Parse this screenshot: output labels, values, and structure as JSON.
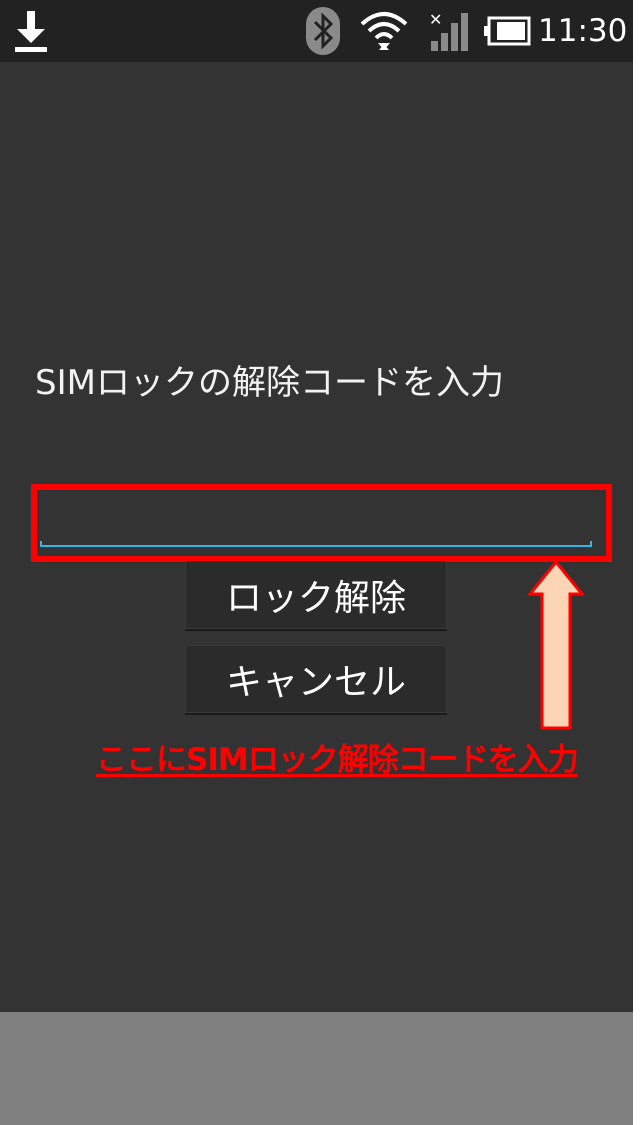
{
  "status_bar": {
    "time": "11:30",
    "icons": [
      "download-icon",
      "bluetooth-icon",
      "wifi-icon",
      "signal-icon",
      "battery-icon"
    ]
  },
  "dialog": {
    "prompt": "SIMロックの解除コードを入力",
    "input_value": "",
    "input_placeholder": "",
    "unlock_label": "ロック解除",
    "cancel_label": "キャンセル"
  },
  "annotation": {
    "text": "ここにSIMロック解除コードを入力"
  },
  "colors": {
    "background": "#333333",
    "status_bar": "#222222",
    "highlight": "#ff0000",
    "input_accent": "#33b5e5",
    "arrow_fill": "#fcd5b5",
    "bottom_panel": "#808080"
  }
}
